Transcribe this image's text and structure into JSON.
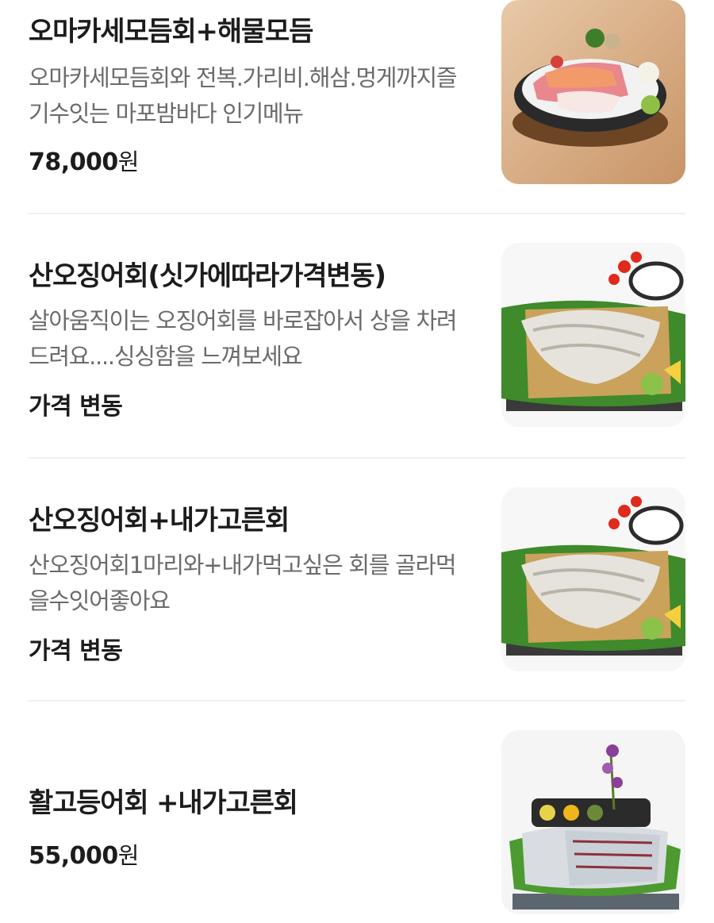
{
  "menu": {
    "items": [
      {
        "name": "오마카세모듬회+해물모듬",
        "description": "오마카세모듬회와 전복.가리비.해삼.멍게까지즐기수잇는 마포밤바다 인기메뉴",
        "price": "78,000",
        "price_unit": "원",
        "image_icon": "sashimi-platter-photo"
      },
      {
        "name": "산오징어회(싯가에따라가격변동)",
        "description": "살아움직이는 오징어회를 바로잡아서 상을 차려드려요....싱싱함을 느껴보세요",
        "price": "가격 변동",
        "price_unit": "",
        "image_icon": "squid-sashimi-photo"
      },
      {
        "name": "산오징어회+내가고른회",
        "description": "산오징어회1마리와+내가먹고싶은 회를 골라먹을수잇어좋아요",
        "price": "가격 변동",
        "price_unit": "",
        "image_icon": "squid-sashimi-photo"
      },
      {
        "name": "활고등어회 +내가고른회",
        "description": "",
        "price": "55,000",
        "price_unit": "원",
        "image_icon": "mackerel-sashimi-photo"
      }
    ]
  }
}
